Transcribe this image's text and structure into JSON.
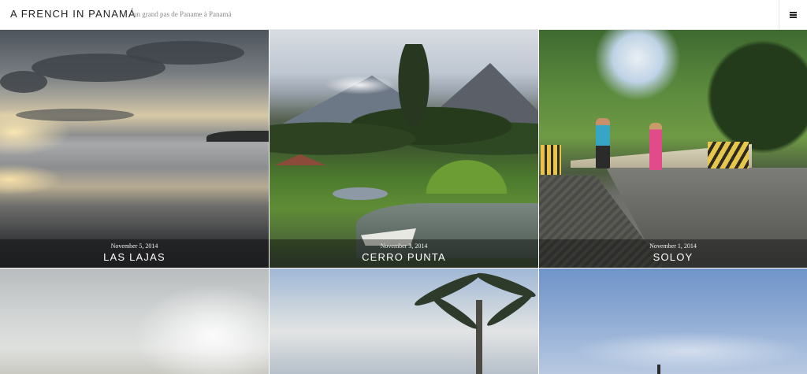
{
  "header": {
    "site_title": "A FRENCH IN PANAMÁ",
    "tagline": "un grand pas de Paname à Panamá",
    "menu_icon": "hamburger-menu-icon"
  },
  "posts": [
    {
      "date": "November 5, 2014",
      "title": "LAS LAJAS"
    },
    {
      "date": "November 3, 2014",
      "title": "CERRO PUNTA"
    },
    {
      "date": "November 1, 2014",
      "title": "SOLOY"
    }
  ],
  "colors": {
    "caption_overlay": "rgba(0,0,0,0.38)",
    "header_bg": "#ffffff",
    "title_color": "#222222",
    "tagline_color": "#8a8a8a"
  }
}
